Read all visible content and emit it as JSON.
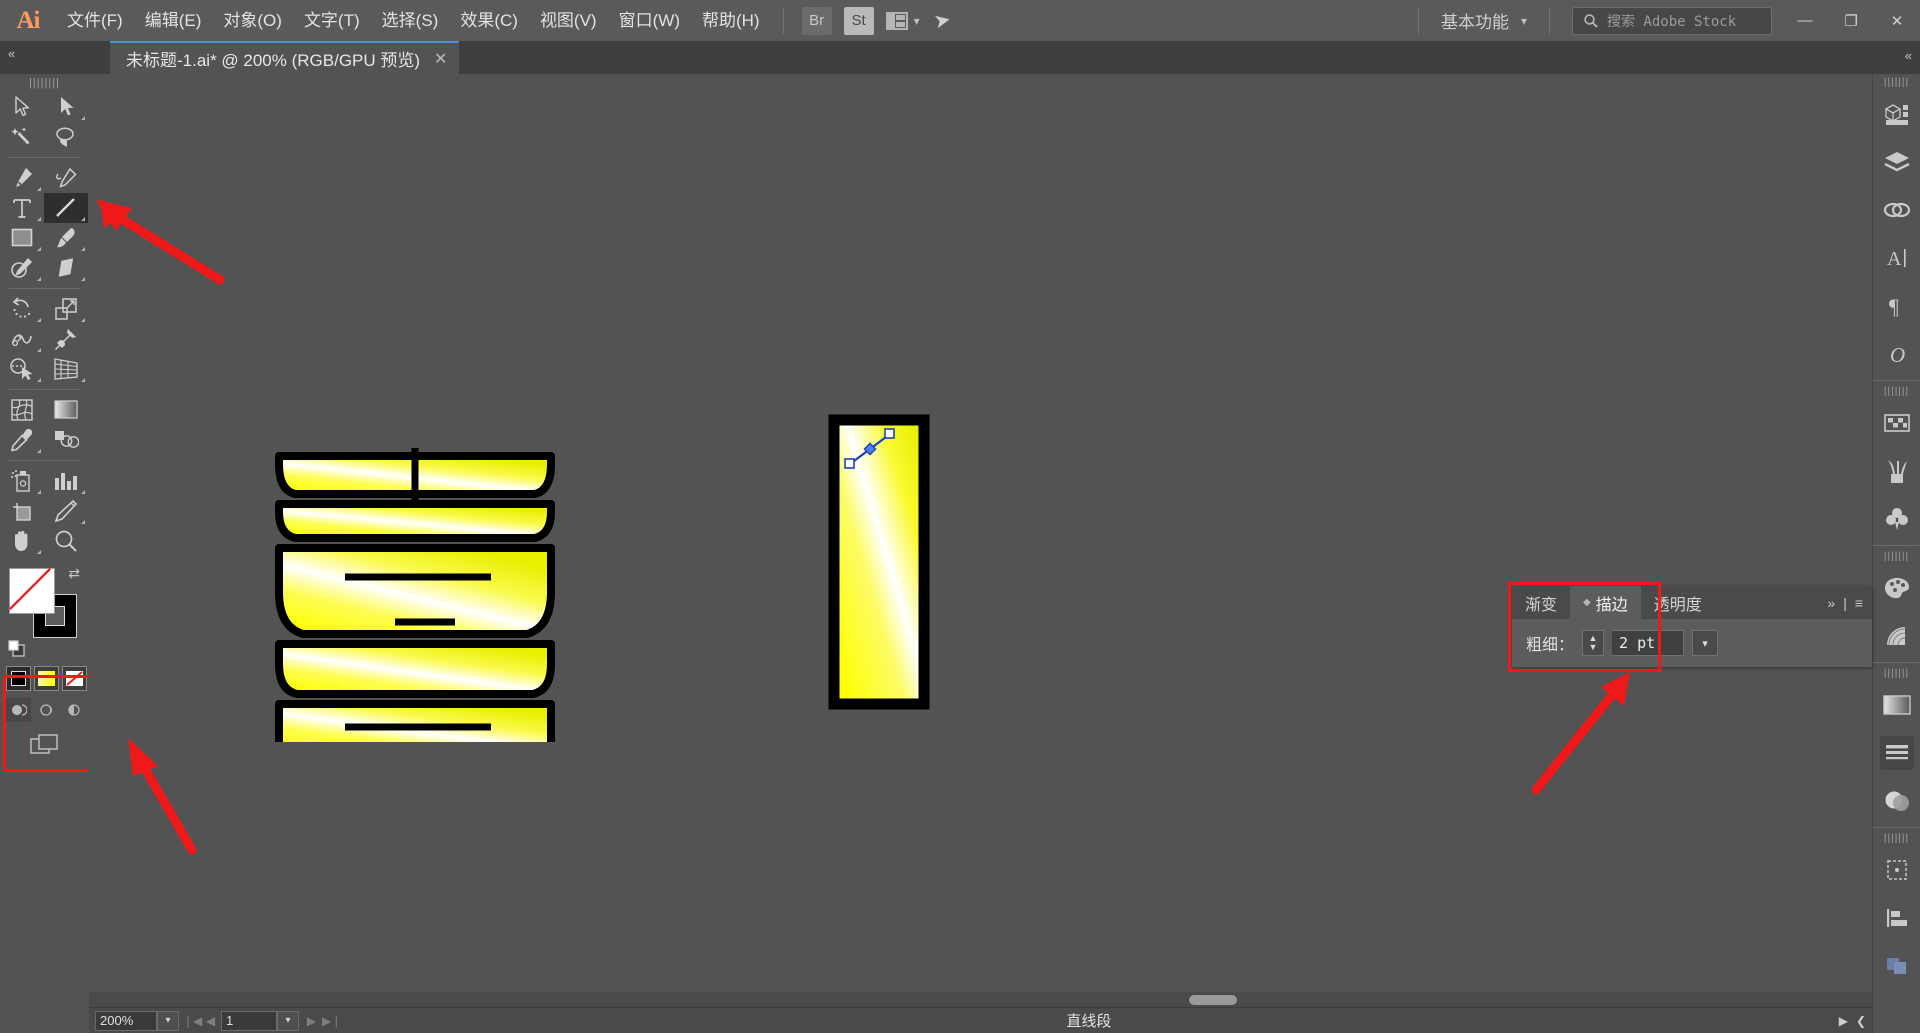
{
  "app": {
    "name": "Adobe Illustrator",
    "logo_text": "Ai"
  },
  "menubar": {
    "items": [
      {
        "label": "文件(F)",
        "name": "menu-file"
      },
      {
        "label": "编辑(E)",
        "name": "menu-edit"
      },
      {
        "label": "对象(O)",
        "name": "menu-object"
      },
      {
        "label": "文字(T)",
        "name": "menu-type"
      },
      {
        "label": "选择(S)",
        "name": "menu-select"
      },
      {
        "label": "效果(C)",
        "name": "menu-effect"
      },
      {
        "label": "视图(V)",
        "name": "menu-view"
      },
      {
        "label": "窗口(W)",
        "name": "menu-window"
      },
      {
        "label": "帮助(H)",
        "name": "menu-help"
      }
    ],
    "bridge_label": "Br",
    "stock_label": "St",
    "workspace": "基本功能",
    "search_placeholder": "搜索 Adobe Stock",
    "window_buttons": {
      "minimize": "—",
      "restore": "❐",
      "close": "✕"
    }
  },
  "tabbar": {
    "document_title": "未标题-1.ai* @ 200% (RGB/GPU 预览)",
    "close_label": "✕"
  },
  "toolbar": {
    "tools": [
      {
        "name": "selection-tool",
        "label": "选择工具"
      },
      {
        "name": "direct-selection-tool",
        "label": "直接选择工具"
      },
      {
        "name": "magic-wand-tool",
        "label": "魔棒工具"
      },
      {
        "name": "lasso-tool",
        "label": "套索工具"
      },
      {
        "name": "pen-tool",
        "label": "钢笔工具"
      },
      {
        "name": "curvature-tool",
        "label": "曲率工具"
      },
      {
        "name": "type-tool",
        "label": "文字工具"
      },
      {
        "name": "line-segment-tool",
        "label": "直线段工具"
      },
      {
        "name": "rectangle-tool",
        "label": "矩形工具"
      },
      {
        "name": "paintbrush-tool",
        "label": "画笔工具"
      },
      {
        "name": "shaper-tool",
        "label": "Shaper 工具"
      },
      {
        "name": "eraser-tool",
        "label": "橡皮擦工具"
      },
      {
        "name": "rotate-tool",
        "label": "旋转工具"
      },
      {
        "name": "scale-tool",
        "label": "比例缩放工具"
      },
      {
        "name": "width-tool",
        "label": "宽度工具"
      },
      {
        "name": "free-transform-tool",
        "label": "自由变换工具"
      },
      {
        "name": "shape-builder-tool",
        "label": "形状生成器工具"
      },
      {
        "name": "perspective-grid-tool",
        "label": "透视网格工具"
      },
      {
        "name": "mesh-tool",
        "label": "网格工具"
      },
      {
        "name": "gradient-tool",
        "label": "渐变工具"
      },
      {
        "name": "eyedropper-tool",
        "label": "吸管工具"
      },
      {
        "name": "blend-tool",
        "label": "混合工具"
      },
      {
        "name": "symbol-sprayer-tool",
        "label": "符号喷枪工具"
      },
      {
        "name": "column-graph-tool",
        "label": "柱形图工具"
      },
      {
        "name": "artboard-tool",
        "label": "画板工具"
      },
      {
        "name": "slice-tool",
        "label": "切片工具"
      },
      {
        "name": "hand-tool",
        "label": "抓手工具"
      },
      {
        "name": "zoom-tool",
        "label": "缩放工具"
      }
    ],
    "selected_tool": "line-segment-tool",
    "colors": {
      "fill": "#ffffff",
      "stroke": "#000000",
      "none_slash": "#e02020",
      "gradient_from": "#f8f8a8",
      "gradient_to": "#ffff00"
    }
  },
  "canvas": {
    "artwork_left": {
      "name": "chinese-character-xi",
      "character": "喜",
      "fill": "gradient yellow",
      "stroke": "#000000"
    },
    "artwork_right": {
      "name": "vertical-bar-shape",
      "fill": "gradient yellow",
      "stroke": "#000000",
      "selected_path": "直线段"
    }
  },
  "stroke_panel": {
    "tabs": [
      {
        "label": "渐变",
        "name": "tab-gradient",
        "active": false
      },
      {
        "label": "描边",
        "name": "tab-stroke",
        "active": true
      },
      {
        "label": "透明度",
        "name": "tab-transparency",
        "active": false
      }
    ],
    "overflow_label": "»",
    "menu_label": "≡",
    "weight_label": "粗细：",
    "weight_value": "2 pt",
    "dropdown_caret": "∨"
  },
  "statusbar": {
    "zoom": "200%",
    "page": "1",
    "current_tool": "直线段",
    "nav_first": "❘◀",
    "nav_prev": "◀",
    "nav_next": "▶",
    "nav_last": "▶❘"
  },
  "dock": {
    "icons": [
      {
        "name": "properties-icon",
        "group": 0
      },
      {
        "name": "layers-icon",
        "group": 0
      },
      {
        "name": "libraries-icon",
        "group": 0
      },
      {
        "name": "character-icon",
        "group": 0
      },
      {
        "name": "paragraph-icon",
        "group": 0
      },
      {
        "name": "glyphs-icon",
        "group": 0
      },
      {
        "name": "swatches-icon",
        "group": 1
      },
      {
        "name": "brushes-icon",
        "group": 1
      },
      {
        "name": "symbols-icon",
        "group": 1
      },
      {
        "name": "color-icon",
        "group": 2
      },
      {
        "name": "color-guide-icon",
        "group": 2
      },
      {
        "name": "gradient-icon",
        "group": 3
      },
      {
        "name": "stroke-icon",
        "group": 3
      },
      {
        "name": "transparency-icon",
        "group": 3
      },
      {
        "name": "transform-icon",
        "group": 4
      },
      {
        "name": "align-icon",
        "group": 4
      },
      {
        "name": "pathfinder-icon",
        "group": 4
      }
    ],
    "collapse_label": "»"
  },
  "annotations": {
    "accent_color": "#f01919",
    "arrows": [
      {
        "name": "arrow-to-line-tool",
        "points": "to line segment tool"
      },
      {
        "name": "arrow-to-color-swatches",
        "points": "to fill and stroke swatches"
      },
      {
        "name": "arrow-to-stroke-weight",
        "points": "to stroke weight field"
      }
    ],
    "boxes": [
      {
        "name": "highlight-box-swatches"
      },
      {
        "name": "highlight-box-stroke-panel"
      }
    ]
  }
}
